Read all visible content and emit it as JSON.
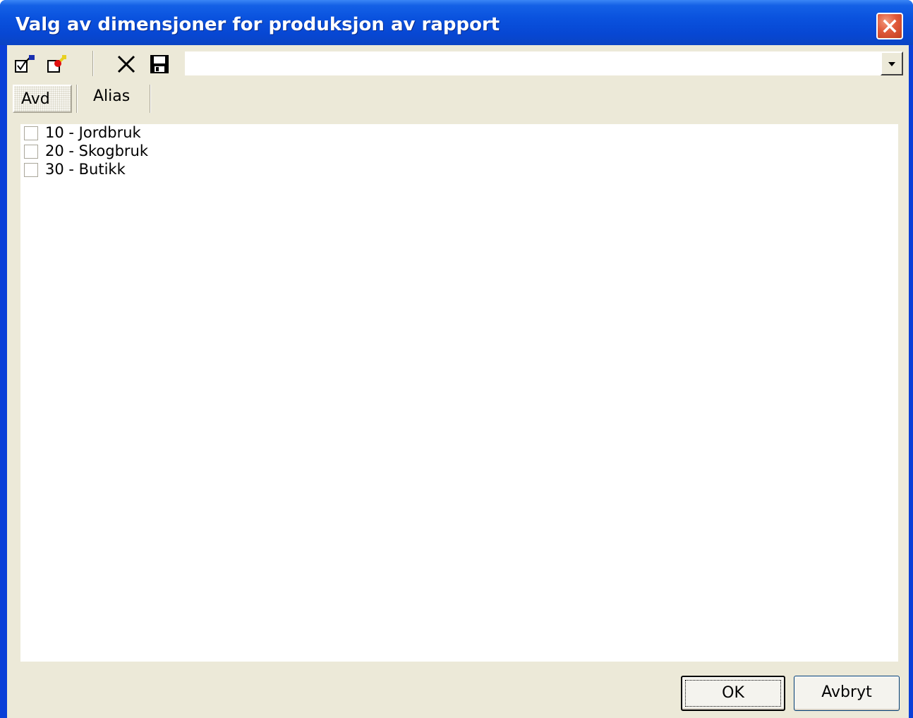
{
  "window": {
    "title": "Valg av dimensjoner for produksjon av rapport"
  },
  "toolbar": {
    "icons": [
      "select-all-icon",
      "deselect-all-icon",
      "delete-icon",
      "save-icon"
    ],
    "combo_value": ""
  },
  "tabs": [
    {
      "label": "Avd",
      "selected": true
    },
    {
      "label": "Alias",
      "selected": false
    }
  ],
  "list": {
    "items": [
      {
        "label": "10 - Jordbruk",
        "checked": false
      },
      {
        "label": "20 - Skogbruk",
        "checked": false
      },
      {
        "label": "30 - Butikk",
        "checked": false
      }
    ]
  },
  "buttons": {
    "ok_label": "OK",
    "cancel_label": "Avbryt"
  },
  "colors": {
    "titlebar": "#0a52de",
    "face": "#ece9d8",
    "close": "#e0593a"
  }
}
